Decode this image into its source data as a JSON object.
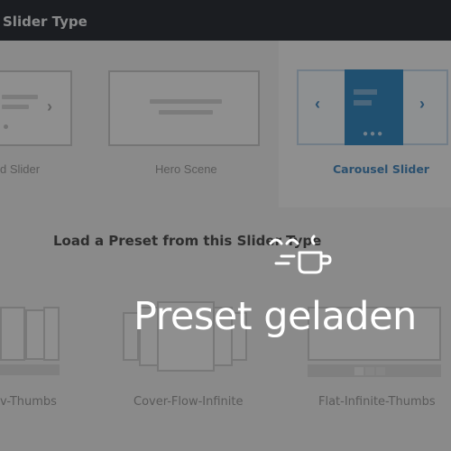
{
  "header": {
    "title": "Slider Type"
  },
  "slider_types": [
    {
      "label": "d Slider"
    },
    {
      "label": "Hero Scene"
    },
    {
      "label": "Carousel Slider",
      "selected": true
    }
  ],
  "presets": {
    "heading": "Load a Preset from this Slider Type",
    "items": [
      {
        "label": "v-Thumbs"
      },
      {
        "label": "Cover-Flow-Infinite"
      },
      {
        "label": "Flat-Infinite-Thumbs"
      }
    ]
  },
  "toast": {
    "message": "Preset geladen",
    "icon": "coffee-icon"
  },
  "colors": {
    "accent": "#1978b9",
    "titlebar": "#0f131b"
  }
}
